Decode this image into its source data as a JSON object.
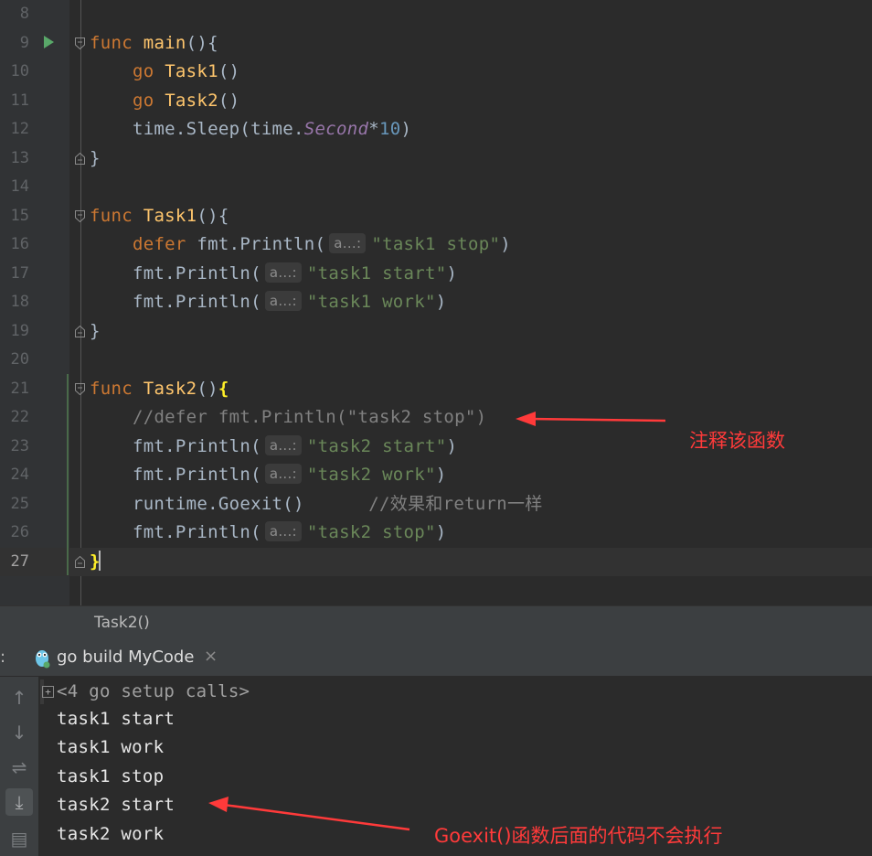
{
  "editor": {
    "lines": [
      {
        "num": "8",
        "segments": []
      },
      {
        "num": "9",
        "segments": [
          {
            "c": "kw",
            "t": "func "
          },
          {
            "c": "fn",
            "t": "main"
          },
          {
            "c": "",
            "t": "(){"
          }
        ]
      },
      {
        "num": "10",
        "segments": [
          {
            "c": "",
            "t": "    "
          },
          {
            "c": "kw",
            "t": "go "
          },
          {
            "c": "fn",
            "t": "Task1"
          },
          {
            "c": "",
            "t": "()"
          }
        ]
      },
      {
        "num": "11",
        "segments": [
          {
            "c": "",
            "t": "    "
          },
          {
            "c": "kw",
            "t": "go "
          },
          {
            "c": "fn",
            "t": "Task2"
          },
          {
            "c": "",
            "t": "()"
          }
        ]
      },
      {
        "num": "12",
        "segments": [
          {
            "c": "",
            "t": "    time.Sleep(time."
          },
          {
            "c": "const",
            "t": "Second"
          },
          {
            "c": "",
            "t": "*"
          },
          {
            "c": "num",
            "t": "10"
          },
          {
            "c": "",
            "t": ")"
          }
        ]
      },
      {
        "num": "13",
        "segments": [
          {
            "c": "",
            "t": "}"
          }
        ]
      },
      {
        "num": "14",
        "segments": []
      },
      {
        "num": "15",
        "segments": [
          {
            "c": "kw",
            "t": "func "
          },
          {
            "c": "fn",
            "t": "Task1"
          },
          {
            "c": "",
            "t": "(){"
          }
        ]
      },
      {
        "num": "16",
        "segments": [
          {
            "c": "",
            "t": "    "
          },
          {
            "c": "kw",
            "t": "defer "
          },
          {
            "c": "",
            "t": "fmt.Println("
          },
          {
            "c": "hint",
            "t": "a...:"
          },
          {
            "c": "str",
            "t": "\"task1 stop\""
          },
          {
            "c": "",
            "t": ")"
          }
        ]
      },
      {
        "num": "17",
        "segments": [
          {
            "c": "",
            "t": "    fmt.Println("
          },
          {
            "c": "hint",
            "t": "a...:"
          },
          {
            "c": "str",
            "t": "\"task1 start\""
          },
          {
            "c": "",
            "t": ")"
          }
        ]
      },
      {
        "num": "18",
        "segments": [
          {
            "c": "",
            "t": "    fmt.Println("
          },
          {
            "c": "hint",
            "t": "a...:"
          },
          {
            "c": "str",
            "t": "\"task1 work\""
          },
          {
            "c": "",
            "t": ")"
          }
        ]
      },
      {
        "num": "19",
        "segments": [
          {
            "c": "",
            "t": "}"
          }
        ]
      },
      {
        "num": "20",
        "segments": []
      },
      {
        "num": "21",
        "segments": [
          {
            "c": "kw",
            "t": "func "
          },
          {
            "c": "fn",
            "t": "Task2"
          },
          {
            "c": "",
            "t": "()"
          },
          {
            "c": "brace-hl",
            "t": "{"
          }
        ]
      },
      {
        "num": "22",
        "segments": [
          {
            "c": "",
            "t": "    "
          },
          {
            "c": "cm",
            "t": "//defer fmt.Println(\"task2 stop\")"
          }
        ]
      },
      {
        "num": "23",
        "segments": [
          {
            "c": "",
            "t": "    fmt.Println("
          },
          {
            "c": "hint",
            "t": "a...:"
          },
          {
            "c": "str",
            "t": "\"task2 start\""
          },
          {
            "c": "",
            "t": ")"
          }
        ]
      },
      {
        "num": "24",
        "segments": [
          {
            "c": "",
            "t": "    fmt.Println("
          },
          {
            "c": "hint",
            "t": "a...:"
          },
          {
            "c": "str",
            "t": "\"task2 work\""
          },
          {
            "c": "",
            "t": ")"
          }
        ]
      },
      {
        "num": "25",
        "segments": [
          {
            "c": "",
            "t": "    runtime.Goexit()      "
          },
          {
            "c": "cm",
            "t": "//效果和return一样"
          }
        ]
      },
      {
        "num": "26",
        "segments": [
          {
            "c": "",
            "t": "    fmt.Println("
          },
          {
            "c": "hint",
            "t": "a...:"
          },
          {
            "c": "str",
            "t": "\"task2 stop\""
          },
          {
            "c": "",
            "t": ")"
          }
        ]
      },
      {
        "num": "27",
        "segments": [
          {
            "c": "brace-hl",
            "t": "}"
          }
        ]
      }
    ],
    "current_line": "27"
  },
  "breadcrumb": "Task2()",
  "run_panel": {
    "colon": ":",
    "tab_label": "go build MyCode",
    "close_glyph": "×",
    "setup_calls": "<4 go setup calls>",
    "output": [
      "task1 start",
      "task1 work",
      "task1 stop",
      "task2 start",
      "task2 work"
    ]
  },
  "toolbar": {
    "up_glyph": "↑",
    "down_glyph": "↓",
    "wrap_glyph": "⇌",
    "scroll_glyph": "⤓",
    "print_glyph": "▤"
  },
  "annotations": {
    "comment_note": "注释该函数",
    "goexit_note": "Goexit()函数后面的代码不会执行"
  },
  "colors": {
    "annotation": "#ff3a3a",
    "keyword": "#cc7832",
    "function": "#ffc66d",
    "string": "#6a8759"
  }
}
